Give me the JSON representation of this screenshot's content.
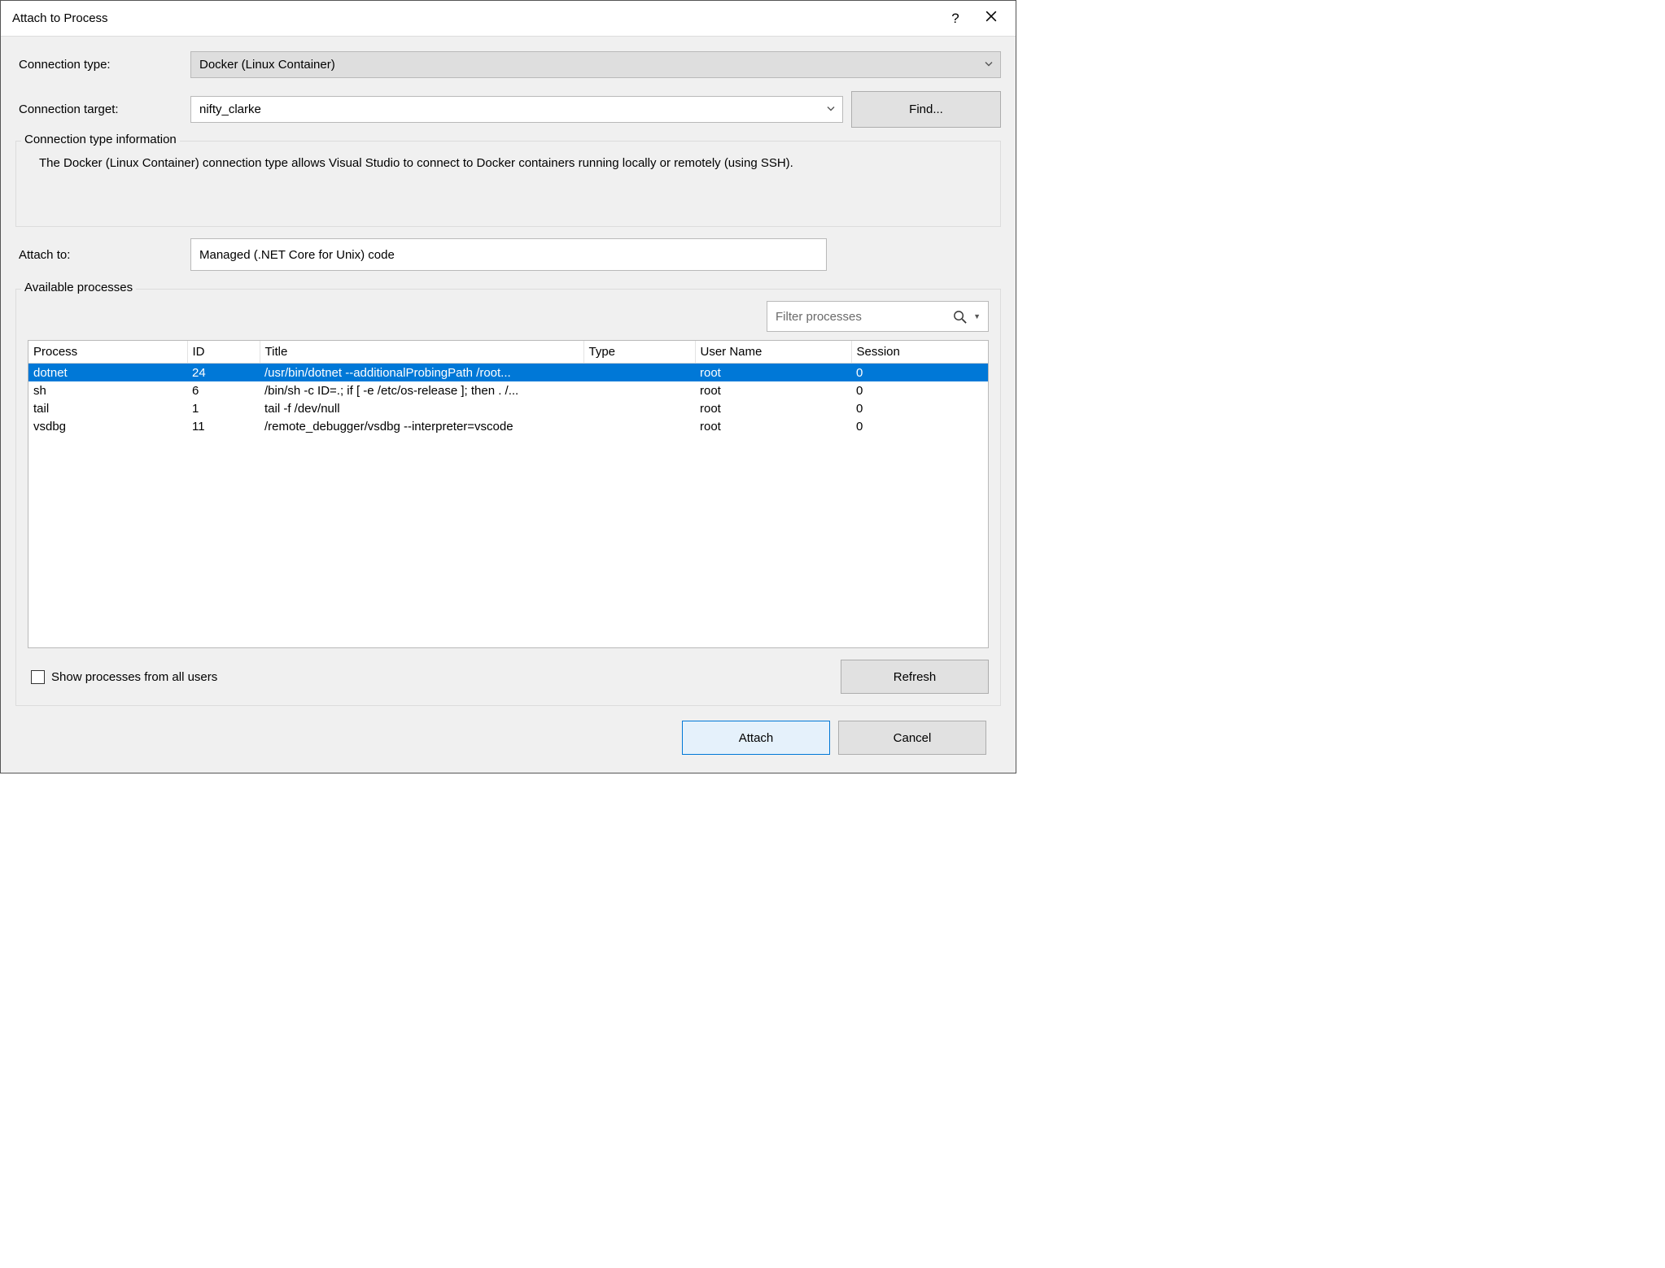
{
  "window": {
    "title": "Attach to Process"
  },
  "labels": {
    "connection_type": "Connection type:",
    "connection_target": "Connection target:",
    "conn_info_title": "Connection type information",
    "conn_info_body": "The Docker (Linux Container) connection type allows Visual Studio to connect to Docker containers running locally or remotely (using SSH).",
    "attach_to": "Attach to:",
    "available_processes": "Available processes",
    "show_all_users": "Show processes from all users"
  },
  "values": {
    "connection_type": "Docker (Linux Container)",
    "connection_target": "nifty_clarke",
    "attach_to": "Managed (.NET Core for Unix) code"
  },
  "buttons": {
    "find": "Find...",
    "refresh": "Refresh",
    "attach": "Attach",
    "cancel": "Cancel"
  },
  "filter": {
    "placeholder": "Filter processes"
  },
  "table": {
    "headers": {
      "process": "Process",
      "id": "ID",
      "title": "Title",
      "type": "Type",
      "user": "User Name",
      "session": "Session"
    },
    "rows": [
      {
        "process": "dotnet",
        "id": "24",
        "title": "/usr/bin/dotnet --additionalProbingPath /root...",
        "type": "",
        "user": "root",
        "session": "0",
        "selected": true
      },
      {
        "process": "sh",
        "id": "6",
        "title": "/bin/sh -c ID=.; if [ -e /etc/os-release ]; then . /...",
        "type": "",
        "user": "root",
        "session": "0",
        "selected": false
      },
      {
        "process": "tail",
        "id": "1",
        "title": "tail -f /dev/null",
        "type": "",
        "user": "root",
        "session": "0",
        "selected": false
      },
      {
        "process": "vsdbg",
        "id": "11",
        "title": "/remote_debugger/vsdbg --interpreter=vscode",
        "type": "",
        "user": "root",
        "session": "0",
        "selected": false
      }
    ]
  }
}
